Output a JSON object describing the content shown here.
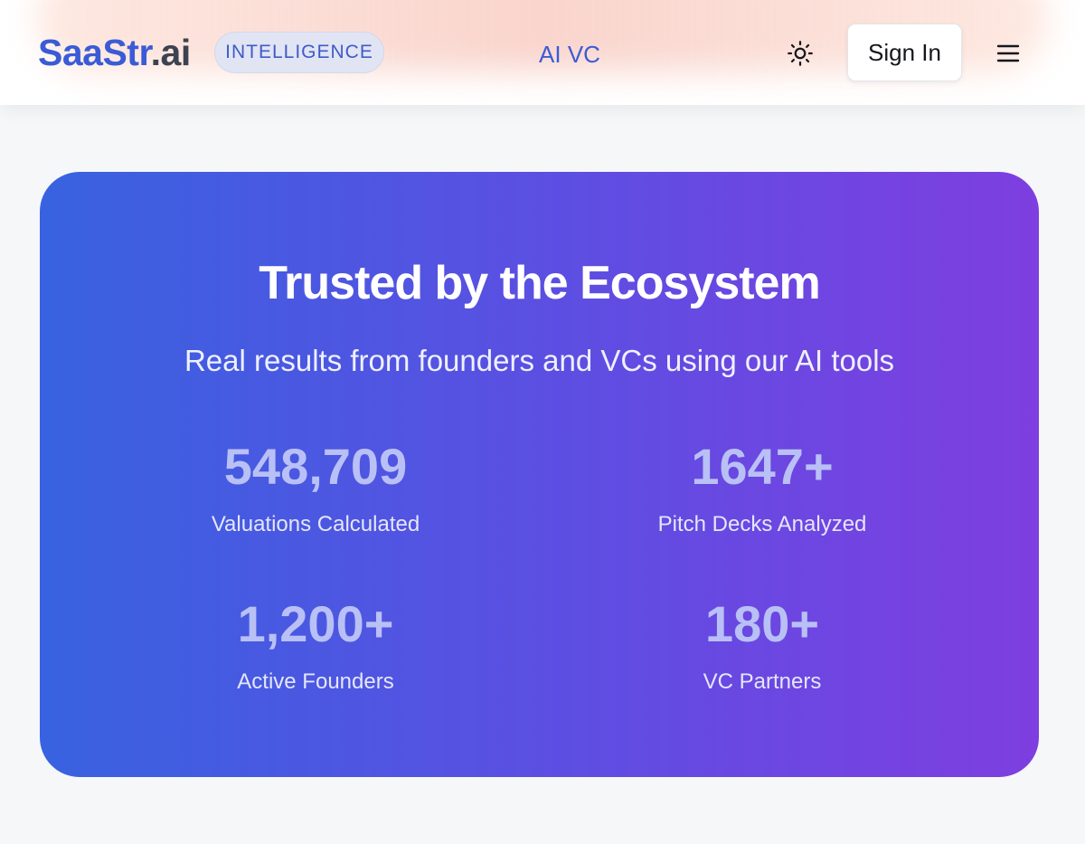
{
  "header": {
    "logo_brand": "SaaStr",
    "logo_tld": ".ai",
    "badge": "INTELLIGENCE",
    "nav_link": "AI VC",
    "theme_icon": "sun-icon",
    "sign_in_label": "Sign In",
    "menu_icon": "hamburger-menu-icon"
  },
  "stats_section": {
    "title": "Trusted by the Ecosystem",
    "subtitle": "Real results from founders and VCs using our AI tools",
    "stats": [
      {
        "value": "548,709",
        "label": "Valuations Calculated"
      },
      {
        "value": "1647+",
        "label": "Pitch Decks Analyzed"
      },
      {
        "value": "1,200+",
        "label": "Active Founders"
      },
      {
        "value": "180+",
        "label": "VC Partners"
      }
    ]
  },
  "colors": {
    "brand_blue": "#3b5bd6",
    "card_gradient_start": "#3862e0",
    "card_gradient_end": "#7e3ee0",
    "stat_value": "#b9c0f6"
  }
}
